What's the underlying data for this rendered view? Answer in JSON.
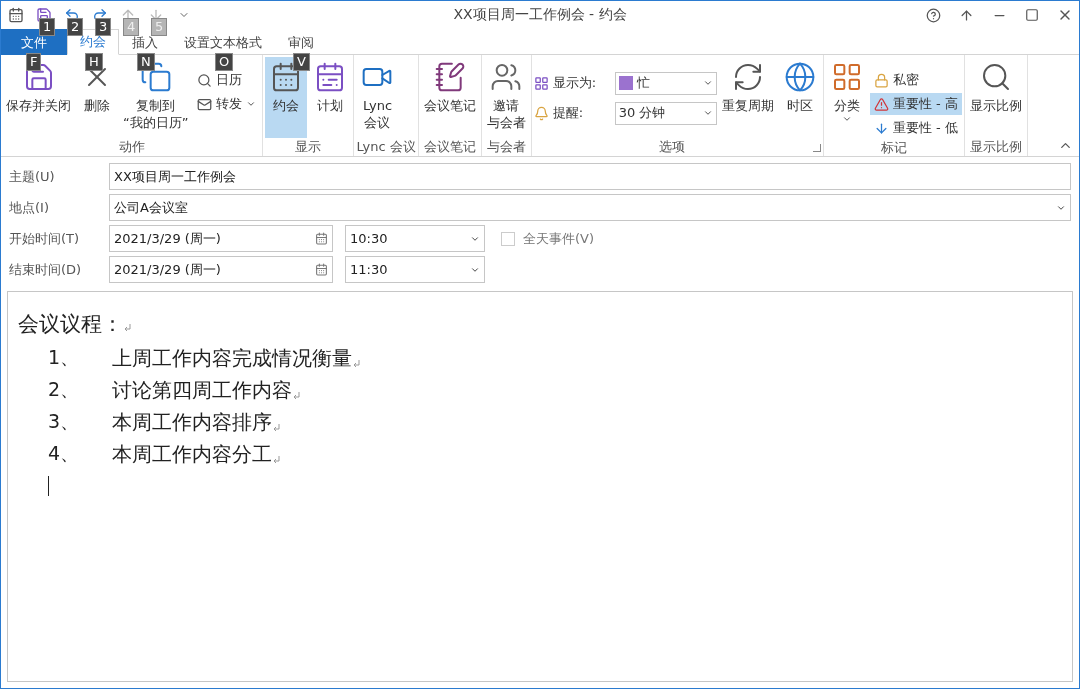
{
  "quick_access": [
    {
      "kind": "calendar"
    },
    {
      "kind": "save",
      "keytip": "1",
      "disabled": false
    },
    {
      "kind": "undo",
      "keytip": "2",
      "disabled": false
    },
    {
      "kind": "redo",
      "keytip": "3",
      "disabled": false
    },
    {
      "kind": "up",
      "keytip": "4",
      "disabled": true
    },
    {
      "kind": "down",
      "keytip": "5",
      "disabled": true
    },
    {
      "kind": "customize"
    }
  ],
  "window": {
    "title": "XX项目周一工作例会 - 约会"
  },
  "tabs": [
    {
      "label": "文件",
      "kind": "file",
      "keytip": "F",
      "selected": false
    },
    {
      "label": "约会",
      "kind": "tab",
      "keytip": "H",
      "selected": true
    },
    {
      "label": "插入",
      "kind": "tab",
      "keytip": "N",
      "selected": false
    },
    {
      "label": "设置文本格式",
      "kind": "tab",
      "keytip": "O",
      "selected": false
    },
    {
      "label": "审阅",
      "kind": "tab",
      "keytip": "V",
      "selected": false
    }
  ],
  "ribbon": [
    {
      "label": "动作",
      "items": [
        {
          "kind": "large",
          "label": "保存并关闭"
        },
        {
          "kind": "large",
          "label": "删除"
        },
        {
          "kind": "large",
          "label": "复制到\n“我的日历”"
        },
        {
          "kind": "small",
          "label": "日历"
        },
        {
          "kind": "small",
          "label": "转发",
          "has_menu": true
        }
      ]
    },
    {
      "label": "显示",
      "items": [
        {
          "kind": "large",
          "label": "约会",
          "selected": true
        },
        {
          "kind": "large",
          "label": "计划",
          "selected": false
        }
      ]
    },
    {
      "label": "Lync 会议",
      "items": [
        {
          "kind": "large",
          "label": "Lync\n会议"
        }
      ]
    },
    {
      "label": "会议笔记",
      "items": [
        {
          "kind": "large",
          "label": "会议笔记"
        }
      ]
    },
    {
      "label": "与会者",
      "items": [
        {
          "kind": "large",
          "label": [
            "邀请",
            "与会者"
          ]
        }
      ]
    },
    {
      "label": "选项",
      "launcher": true,
      "items": [
        {
          "kind": "field",
          "label": "显示为:",
          "value": "忙",
          "color": "#9b72cf"
        },
        {
          "kind": "field",
          "label": "提醒:",
          "value": "30 分钟"
        },
        {
          "kind": "large",
          "label": "重复周期"
        },
        {
          "kind": "large",
          "label": "时区"
        }
      ]
    },
    {
      "label": "标记",
      "items": [
        {
          "kind": "large",
          "label": "分类",
          "has_menu": true
        },
        {
          "kind": "small",
          "label": "私密",
          "selected": false
        },
        {
          "kind": "small",
          "label": "重要性 - 高",
          "selected": true
        },
        {
          "kind": "small",
          "label": "重要性 - 低",
          "selected": false
        }
      ]
    },
    {
      "label": "显示比例",
      "items": [
        {
          "kind": "large",
          "label": "显示比例"
        }
      ]
    }
  ],
  "form": {
    "subject": {
      "label": "主题(U)",
      "value": "XX项目周一工作例会"
    },
    "location": {
      "label": "地点(I)",
      "value": "公司A会议室"
    },
    "start": {
      "label": "开始时间(T)",
      "date": "2021/3/29 (周一)",
      "time": "10:30"
    },
    "all_day": {
      "label": "全天事件(V)",
      "checked": false
    },
    "end": {
      "label": "结束时间(D)",
      "date": "2021/3/29 (周一)",
      "time": "11:30"
    }
  },
  "body": {
    "heading": "会议议程：",
    "items": [
      {
        "number": "1、",
        "text": "上周工作内容完成情况衡量"
      },
      {
        "number": "2、",
        "text": "讨论第四周工作内容"
      },
      {
        "number": "3、",
        "text": "本周工作内容排序"
      },
      {
        "number": "4、",
        "text": "本周工作内容分工"
      }
    ]
  }
}
